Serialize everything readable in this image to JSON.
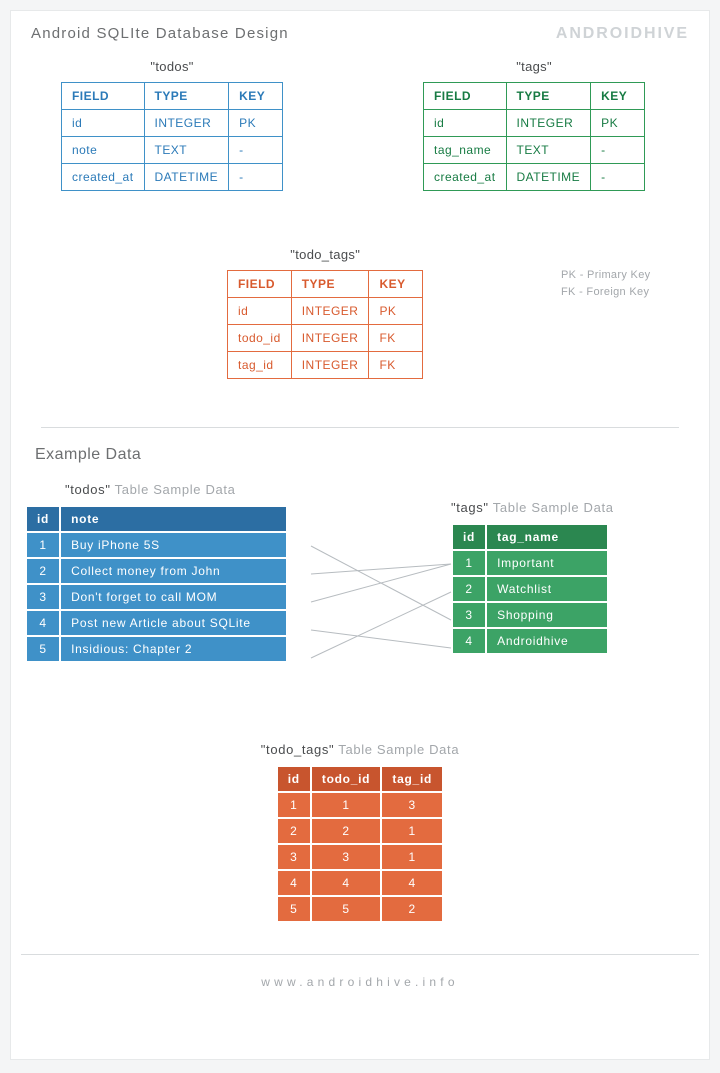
{
  "header": {
    "title": "Android SQLIte Database Design",
    "brand_a": "ANDROID",
    "brand_b": "HIVE"
  },
  "schema_tables": {
    "cols": [
      "FIELD",
      "TYPE",
      "KEY"
    ],
    "todos": {
      "name": "\"todos\"",
      "rows": [
        [
          "id",
          "INTEGER",
          "PK"
        ],
        [
          "note",
          "TEXT",
          "-"
        ],
        [
          "created_at",
          "DATETIME",
          "-"
        ]
      ]
    },
    "tags": {
      "name": "\"tags\"",
      "rows": [
        [
          "id",
          "INTEGER",
          "PK"
        ],
        [
          "tag_name",
          "TEXT",
          "-"
        ],
        [
          "created_at",
          "DATETIME",
          "-"
        ]
      ]
    },
    "todo_tags": {
      "name": "\"todo_tags\"",
      "rows": [
        [
          "id",
          "INTEGER",
          "PK"
        ],
        [
          "todo_id",
          "INTEGER",
          "FK"
        ],
        [
          "tag_id",
          "INTEGER",
          "FK"
        ]
      ]
    }
  },
  "legend": {
    "pk": "PK - Primary Key",
    "fk": "FK - Foreign Key"
  },
  "example_heading": "Example Data",
  "sample_caption_suffix": " Table Sample Data",
  "samples": {
    "todos": {
      "caption": "\"todos\"",
      "headers": [
        "id",
        "note"
      ],
      "rows": [
        [
          "1",
          "Buy iPhone 5S"
        ],
        [
          "2",
          "Collect money from John"
        ],
        [
          "3",
          "Don't forget to call MOM"
        ],
        [
          "4",
          "Post new Article about SQLite"
        ],
        [
          "5",
          "Insidious: Chapter 2"
        ]
      ]
    },
    "tags": {
      "caption": "\"tags\"",
      "headers": [
        "id",
        "tag_name"
      ],
      "rows": [
        [
          "1",
          "Important"
        ],
        [
          "2",
          "Watchlist"
        ],
        [
          "3",
          "Shopping"
        ],
        [
          "4",
          "Androidhive"
        ]
      ]
    },
    "todo_tags": {
      "caption": "\"todo_tags\"",
      "headers": [
        "id",
        "todo_id",
        "tag_id"
      ],
      "rows": [
        [
          "1",
          "1",
          "3"
        ],
        [
          "2",
          "2",
          "1"
        ],
        [
          "3",
          "3",
          "1"
        ],
        [
          "4",
          "4",
          "4"
        ],
        [
          "5",
          "5",
          "2"
        ]
      ]
    }
  },
  "links": [
    {
      "from": 1,
      "to": 3
    },
    {
      "from": 2,
      "to": 1
    },
    {
      "from": 3,
      "to": 1
    },
    {
      "from": 4,
      "to": 4
    },
    {
      "from": 5,
      "to": 2
    }
  ],
  "footer": "www.androidhive.info"
}
